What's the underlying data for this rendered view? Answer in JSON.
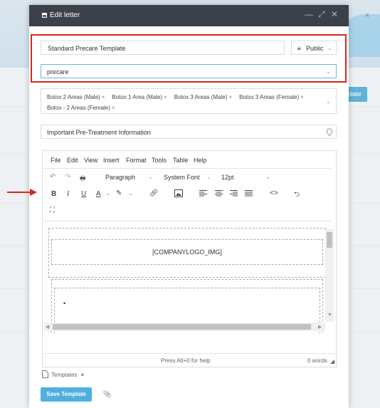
{
  "background": {
    "button_label": "plate",
    "close_glyph": "×"
  },
  "modal": {
    "title": "Edit letter",
    "template_name": "Standard Precare Template",
    "visibility": "Public",
    "category": "precare",
    "tags": [
      "Botox 2 Areas (Male)",
      "Botox 1 Area (Male)",
      "Botox 3 Areas (Male)",
      "Botox 3 Areas (Female)",
      "Botox - 2 Areas (Female)"
    ],
    "subject": "Important Pre-Treatment Information"
  },
  "editor": {
    "menu": [
      "File",
      "Edit",
      "View",
      "Insert",
      "Format",
      "Tools",
      "Table",
      "Help"
    ],
    "format_block": "Paragraph",
    "font_family": "System Font",
    "font_size": "12pt",
    "content_placeholder": "[COMPANYLOGO_IMG]",
    "status_help": "Press Alt+0 for help",
    "word_count": "0 words"
  },
  "footer": {
    "templates_label": "Templates",
    "save_label": "Save Template"
  },
  "colors": {
    "header_bg": "#3a4149",
    "accent": "#4fb0dd",
    "highlight_red": "#d9261c"
  }
}
